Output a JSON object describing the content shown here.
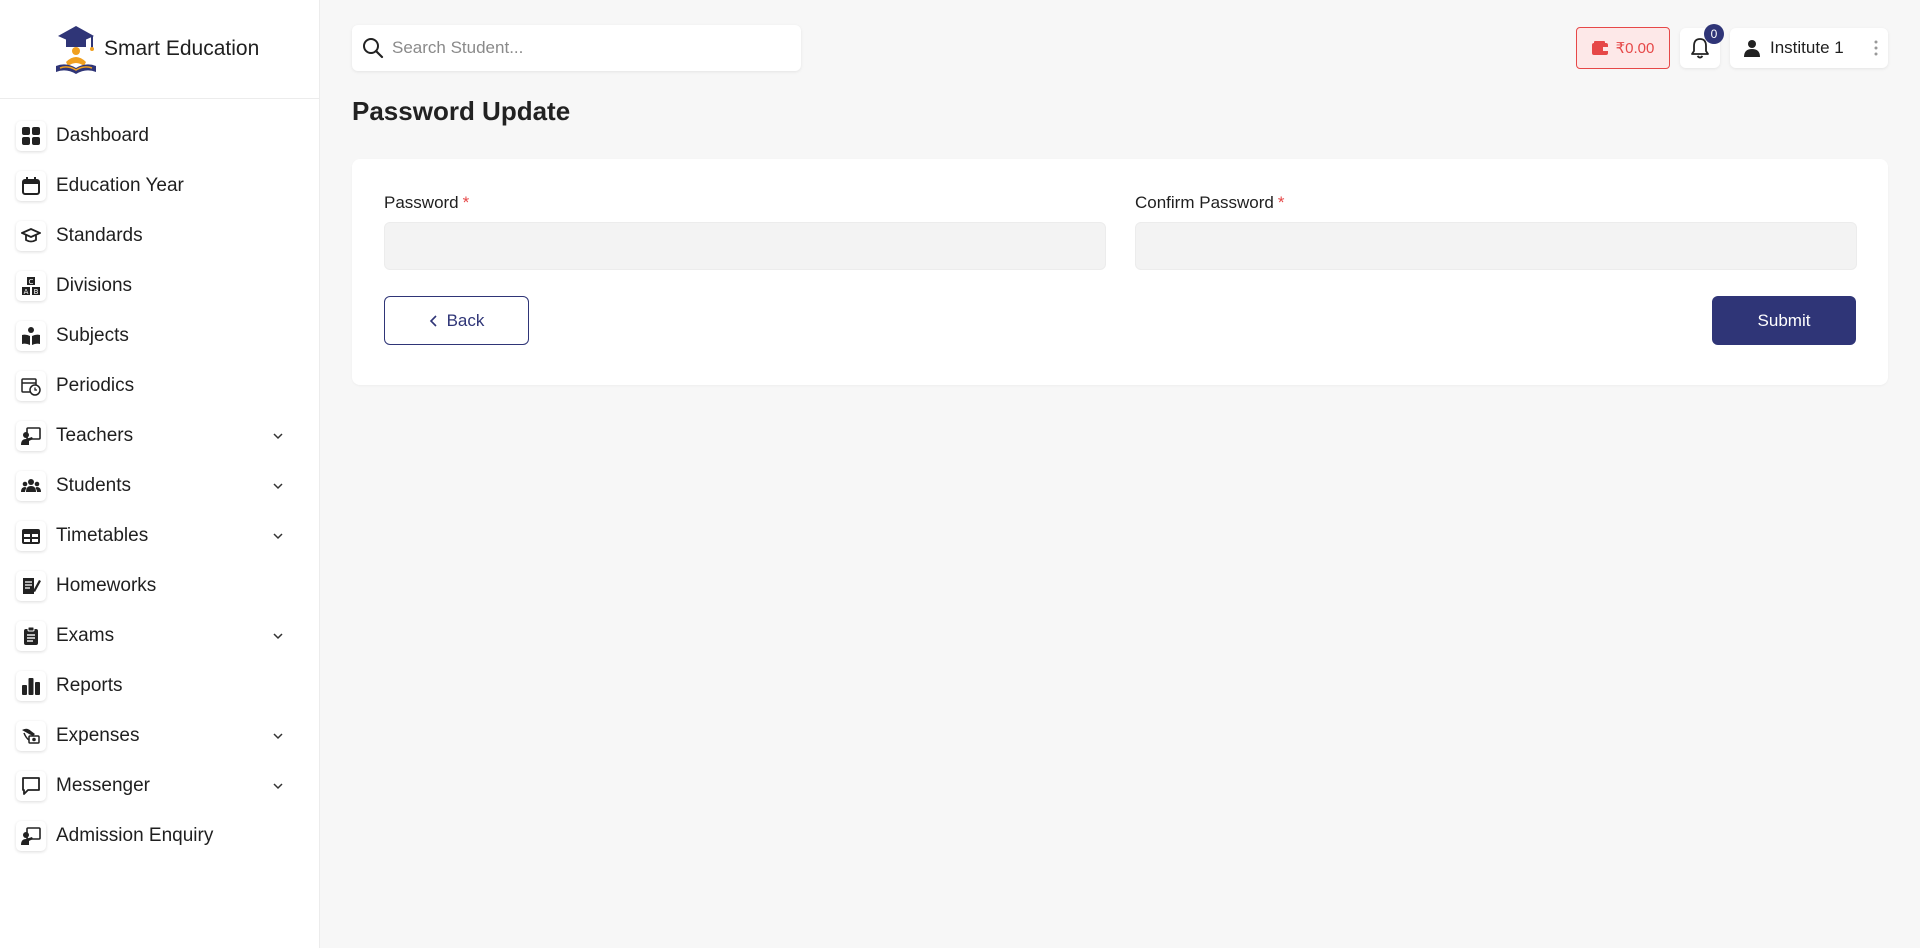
{
  "brand": {
    "name": "Smart Education"
  },
  "search": {
    "placeholder": "Search Student..."
  },
  "wallet": {
    "amount": "₹0.00"
  },
  "notifications": {
    "count": "0"
  },
  "user": {
    "name": "Institute 1"
  },
  "page": {
    "title": "Password Update"
  },
  "form": {
    "password_label": "Password",
    "confirm_label": "Confirm Password",
    "required_mark": "*",
    "back_label": "Back",
    "submit_label": "Submit"
  },
  "sidebar": {
    "items": [
      {
        "label": "Dashboard",
        "icon": "dashboard-grid-icon",
        "expandable": false
      },
      {
        "label": "Education Year",
        "icon": "calendar-icon",
        "expandable": false
      },
      {
        "label": "Standards",
        "icon": "graduation-cap-icon",
        "expandable": false
      },
      {
        "label": "Divisions",
        "icon": "abc-blocks-icon",
        "expandable": false
      },
      {
        "label": "Subjects",
        "icon": "book-reader-icon",
        "expandable": false
      },
      {
        "label": "Periodics",
        "icon": "calendar-clock-icon",
        "expandable": false
      },
      {
        "label": "Teachers",
        "icon": "teacher-board-icon",
        "expandable": true
      },
      {
        "label": "Students",
        "icon": "users-group-icon",
        "expandable": true
      },
      {
        "label": "Timetables",
        "icon": "table-icon",
        "expandable": true
      },
      {
        "label": "Homeworks",
        "icon": "pen-document-icon",
        "expandable": false
      },
      {
        "label": "Exams",
        "icon": "clipboard-list-icon",
        "expandable": true
      },
      {
        "label": "Reports",
        "icon": "bar-chart-icon",
        "expandable": false
      },
      {
        "label": "Expenses",
        "icon": "hand-money-icon",
        "expandable": true
      },
      {
        "label": "Messenger",
        "icon": "chat-bubble-icon",
        "expandable": true
      },
      {
        "label": "Admission Enquiry",
        "icon": "teacher-board-icon",
        "expandable": false
      }
    ]
  },
  "colors": {
    "primary": "#2f3577",
    "danger": "#e64848",
    "background": "#f7f7f7",
    "input_bg": "#f3f3f3"
  }
}
